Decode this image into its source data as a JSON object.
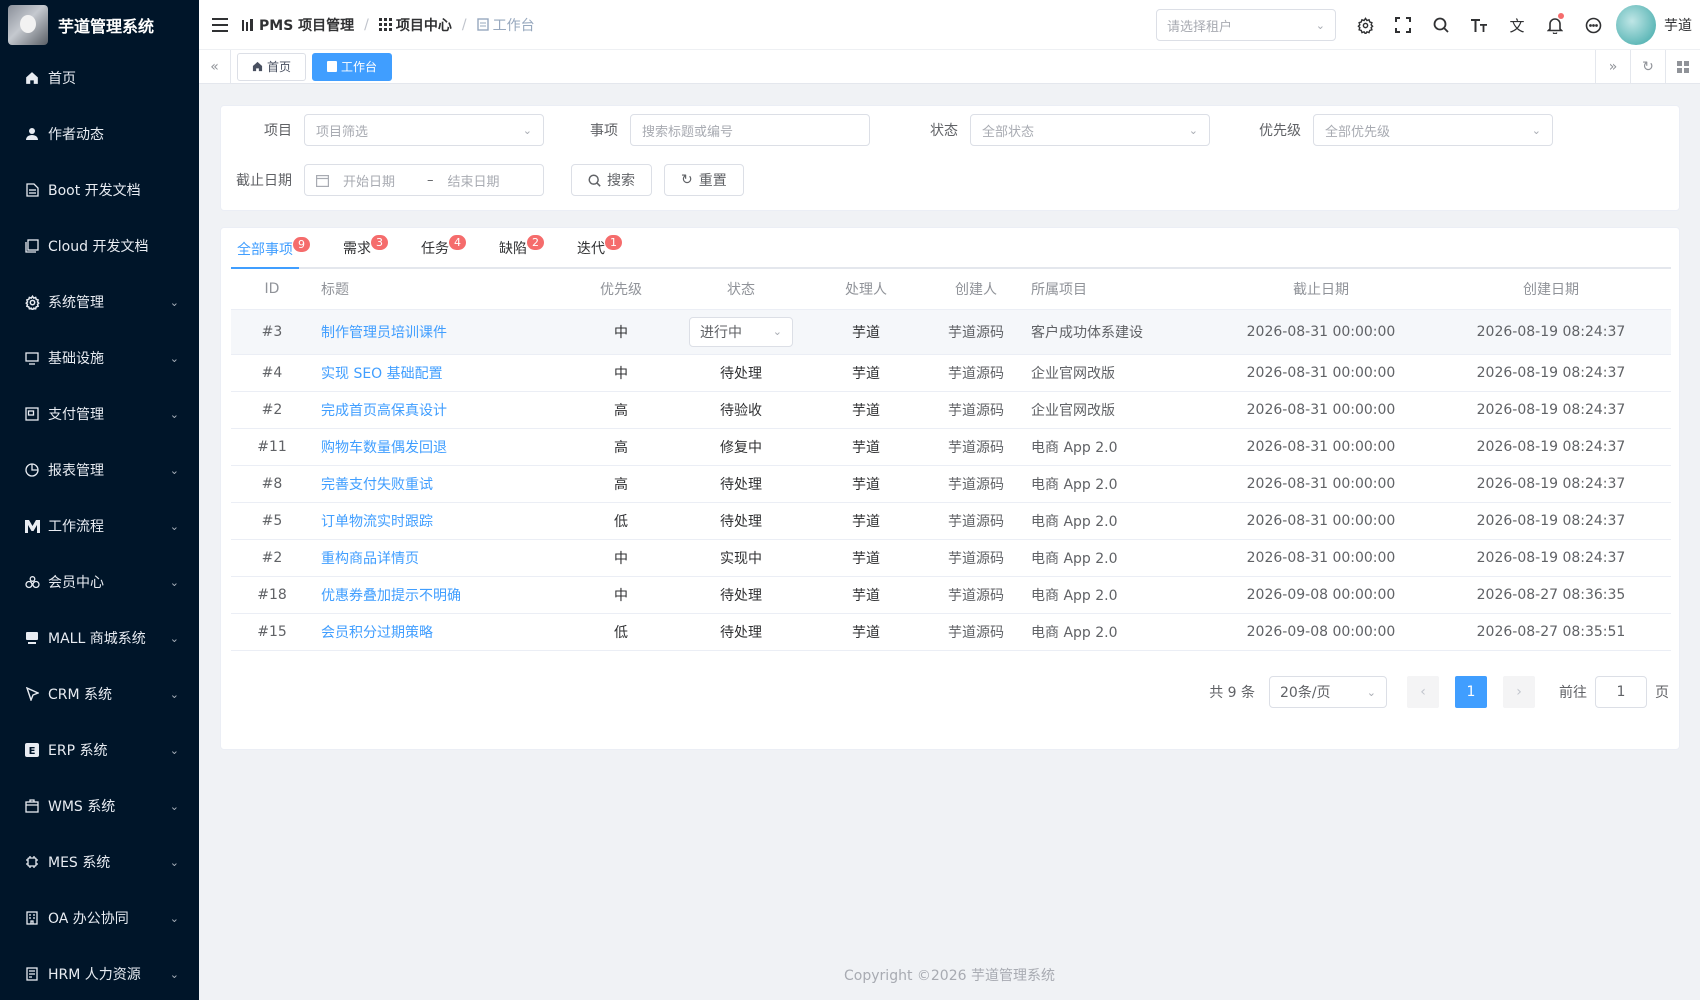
{
  "app": {
    "title": "芋道管理系统"
  },
  "sidebar": {
    "items": [
      {
        "icon": "home-icon",
        "label": "首页",
        "has_arrow": false
      },
      {
        "icon": "user-icon",
        "label": "作者动态",
        "has_arrow": false
      },
      {
        "icon": "document-icon",
        "label": "Boot 开发文档",
        "has_arrow": false
      },
      {
        "icon": "documents-icon",
        "label": "Cloud 开发文档",
        "has_arrow": false
      },
      {
        "icon": "gear-icon",
        "label": "系统管理",
        "has_arrow": true
      },
      {
        "icon": "monitor-icon",
        "label": "基础设施",
        "has_arrow": true
      },
      {
        "icon": "payment-icon",
        "label": "支付管理",
        "has_arrow": true
      },
      {
        "icon": "pie-chart-icon",
        "label": "报表管理",
        "has_arrow": true
      },
      {
        "icon": "workflow-icon",
        "label": "工作流程",
        "has_arrow": true
      },
      {
        "icon": "members-icon",
        "label": "会员中心",
        "has_arrow": true
      },
      {
        "icon": "shop-icon",
        "label": "MALL 商城系统",
        "has_arrow": true
      },
      {
        "icon": "crm-icon",
        "label": "CRM 系统",
        "has_arrow": true
      },
      {
        "icon": "erp-icon",
        "label": "ERP 系统",
        "has_arrow": true
      },
      {
        "icon": "warehouse-icon",
        "label": "WMS 系统",
        "has_arrow": true
      },
      {
        "icon": "chip-icon",
        "label": "MES 系统",
        "has_arrow": true
      },
      {
        "icon": "office-icon",
        "label": "OA 办公协同",
        "has_arrow": true
      },
      {
        "icon": "hr-icon",
        "label": "HRM 人力资源",
        "has_arrow": true
      }
    ]
  },
  "breadcrumb": [
    {
      "icon": "pms-icon",
      "label": "PMS 项目管理"
    },
    {
      "icon": "grid-icon",
      "label": "项目中心"
    },
    {
      "icon": "workbench-icon",
      "label": "工作台"
    }
  ],
  "topbar": {
    "tenant_placeholder": "请选择租户",
    "username": "芋道"
  },
  "tags": [
    {
      "label": "首页",
      "active": false
    },
    {
      "label": "工作台",
      "active": true
    }
  ],
  "filters": {
    "project_label": "项目",
    "project_placeholder": "项目筛选",
    "item_label": "事项",
    "item_placeholder": "搜索标题或编号",
    "status_label": "状态",
    "status_placeholder": "全部状态",
    "priority_label": "优先级",
    "priority_placeholder": "全部优先级",
    "deadline_label": "截止日期",
    "start_placeholder": "开始日期",
    "range_sep": "–",
    "end_placeholder": "结束日期",
    "search_button": "搜索",
    "reset_button": "重置"
  },
  "tabs": [
    {
      "label": "全部事项",
      "badge": "9",
      "active": true
    },
    {
      "label": "需求",
      "badge": "3",
      "active": false
    },
    {
      "label": "任务",
      "badge": "4",
      "active": false
    },
    {
      "label": "缺陷",
      "badge": "2",
      "active": false
    },
    {
      "label": "迭代",
      "badge": "1",
      "active": false
    }
  ],
  "table": {
    "headers": [
      "ID",
      "标题",
      "优先级",
      "状态",
      "处理人",
      "创建人",
      "所属项目",
      "截止日期",
      "创建日期"
    ],
    "rows": [
      {
        "id": "#3",
        "title": "制作管理员培训课件",
        "priority": "中",
        "status": "进行中",
        "status_dropdown": true,
        "assignee": "芋道",
        "creator": "芋道源码",
        "project": "客户成功体系建设",
        "deadline": "2026-08-31 00:00:00",
        "created": "2026-08-19 08:24:37"
      },
      {
        "id": "#4",
        "title": "实现 SEO 基础配置",
        "priority": "中",
        "status": "待处理",
        "status_dropdown": false,
        "assignee": "芋道",
        "creator": "芋道源码",
        "project": "企业官网改版",
        "deadline": "2026-08-31 00:00:00",
        "created": "2026-08-19 08:24:37"
      },
      {
        "id": "#2",
        "title": "完成首页高保真设计",
        "priority": "高",
        "status": "待验收",
        "status_dropdown": false,
        "assignee": "芋道",
        "creator": "芋道源码",
        "project": "企业官网改版",
        "deadline": "2026-08-31 00:00:00",
        "created": "2026-08-19 08:24:37"
      },
      {
        "id": "#11",
        "title": "购物车数量偶发回退",
        "priority": "高",
        "status": "修复中",
        "status_dropdown": false,
        "assignee": "芋道",
        "creator": "芋道源码",
        "project": "电商 App 2.0",
        "deadline": "2026-08-31 00:00:00",
        "created": "2026-08-19 08:24:37"
      },
      {
        "id": "#8",
        "title": "完善支付失败重试",
        "priority": "高",
        "status": "待处理",
        "status_dropdown": false,
        "assignee": "芋道",
        "creator": "芋道源码",
        "project": "电商 App 2.0",
        "deadline": "2026-08-31 00:00:00",
        "created": "2026-08-19 08:24:37"
      },
      {
        "id": "#5",
        "title": "订单物流实时跟踪",
        "priority": "低",
        "status": "待处理",
        "status_dropdown": false,
        "assignee": "芋道",
        "creator": "芋道源码",
        "project": "电商 App 2.0",
        "deadline": "2026-08-31 00:00:00",
        "created": "2026-08-19 08:24:37"
      },
      {
        "id": "#2",
        "title": "重构商品详情页",
        "priority": "中",
        "status": "实现中",
        "status_dropdown": false,
        "assignee": "芋道",
        "creator": "芋道源码",
        "project": "电商 App 2.0",
        "deadline": "2026-08-31 00:00:00",
        "created": "2026-08-19 08:24:37"
      },
      {
        "id": "#18",
        "title": "优惠券叠加提示不明确",
        "priority": "中",
        "status": "待处理",
        "status_dropdown": false,
        "assignee": "芋道",
        "creator": "芋道源码",
        "project": "电商 App 2.0",
        "deadline": "2026-09-08 00:00:00",
        "created": "2026-08-27 08:36:35"
      },
      {
        "id": "#15",
        "title": "会员积分过期策略",
        "priority": "低",
        "status": "待处理",
        "status_dropdown": false,
        "assignee": "芋道",
        "creator": "芋道源码",
        "project": "电商 App 2.0",
        "deadline": "2026-09-08 00:00:00",
        "created": "2026-08-27 08:35:51"
      }
    ]
  },
  "pagination": {
    "total_text": "共 9 条",
    "page_size": "20条/页",
    "current_page": "1",
    "goto_label": "前往",
    "goto_value": "1",
    "page_unit": "页"
  },
  "footer": {
    "copyright": "Copyright ©2026 芋道管理系统"
  },
  "colors": {
    "primary": "#409eff",
    "sidebar_bg": "#001529",
    "badge": "#f56c6c"
  }
}
